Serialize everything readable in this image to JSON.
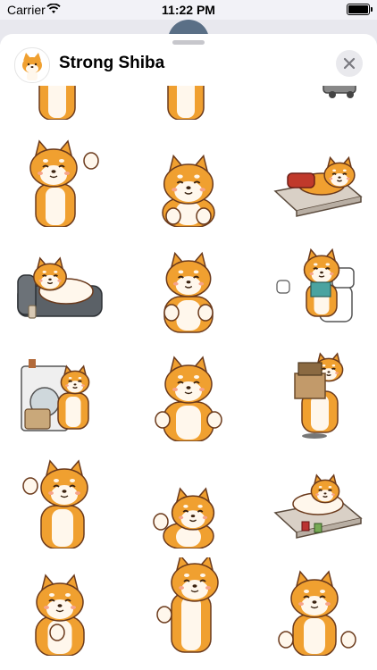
{
  "status_bar": {
    "carrier": "Carrier",
    "time": "11:22 PM",
    "wifi_icon": "wifi-icon",
    "battery_icon": "battery-icon"
  },
  "header": {
    "title": "Strong Shiba",
    "app_icon": "shiba-app-icon",
    "close_icon": "close-icon"
  },
  "stickers": [
    {
      "pose": "waving-cropped"
    },
    {
      "pose": "waving-cropped"
    },
    {
      "pose": "vacuum-cropped"
    },
    {
      "pose": "waving"
    },
    {
      "pose": "peeking"
    },
    {
      "pose": "sleeping-on-mat"
    },
    {
      "pose": "lying-on-sofa"
    },
    {
      "pose": "sitting"
    },
    {
      "pose": "toilet-reading"
    },
    {
      "pose": "laundry-machine"
    },
    {
      "pose": "fists-up"
    },
    {
      "pose": "carrying-boxes"
    },
    {
      "pose": "waving-smile"
    },
    {
      "pose": "peek-waving"
    },
    {
      "pose": "lying-on-mat"
    },
    {
      "pose": "thinking"
    },
    {
      "pose": "thumbs-up"
    },
    {
      "pose": "pointing"
    }
  ],
  "colors": {
    "fur": "#f0a030",
    "fur_dark": "#d98518",
    "cream": "#fff7ec",
    "outline": "#6b3a1c",
    "blush": "#f6a38a"
  }
}
